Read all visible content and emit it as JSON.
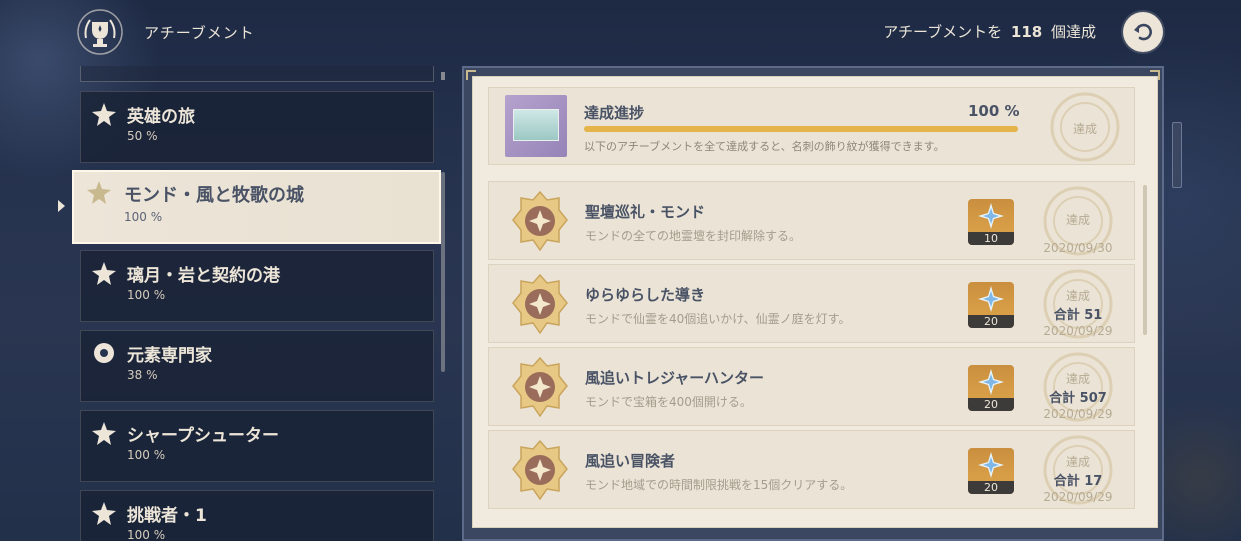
{
  "header": {
    "title": "アチーブメント",
    "progress_prefix": "アチーブメントを",
    "progress_count": "118",
    "progress_suffix": "個達成"
  },
  "sidebar": {
    "categories": [
      {
        "name": "英雄の旅",
        "percent": "50 %"
      },
      {
        "name": "モンド・風と牧歌の城",
        "percent": "100 %",
        "selected": true
      },
      {
        "name": "璃月・岩と契約の港",
        "percent": "100 %"
      },
      {
        "name": "元素専門家",
        "percent": "38 %"
      },
      {
        "name": "シャープシューター",
        "percent": "100 %"
      },
      {
        "name": "挑戦者・1",
        "percent": "100 %"
      }
    ]
  },
  "summary": {
    "title": "達成進捗",
    "percent_label": "100 %",
    "progress": 1.0,
    "description": "以下のアチーブメントを全て達成すると、名刺の飾り紋が獲得できます。",
    "stamp_label": "達成"
  },
  "achievements": [
    {
      "title": "聖壇巡礼・モンド",
      "description": "モンドの全ての地霊壇を封印解除する。",
      "reward_qty": "10",
      "stamp_label": "達成",
      "total": "",
      "date": "2020/09/30"
    },
    {
      "title": "ゆらゆらした導き",
      "description": "モンドで仙霊を40個追いかけ、仙霊ノ庭を灯す。",
      "reward_qty": "20",
      "stamp_label": "達成",
      "total": "合計 51",
      "date": "2020/09/29"
    },
    {
      "title": "風追いトレジャーハンター",
      "description": "モンドで宝箱を400個開ける。",
      "reward_qty": "20",
      "stamp_label": "達成",
      "total": "合計 507",
      "date": "2020/09/29"
    },
    {
      "title": "風追い冒険者",
      "description": "モンド地域での時間制限挑戦を15個クリアする。",
      "reward_qty": "20",
      "stamp_label": "達成",
      "total": "合計 17",
      "date": "2020/09/29"
    }
  ],
  "colors": {
    "accent_gold": "#e5b54c",
    "panel_bg": "#f1ebdf",
    "text_dark": "#4a5366",
    "reward_bg": "#d69a45"
  },
  "icons": {
    "header": "trophy-emblem-icon",
    "back": "back-arrow-icon",
    "medal": "achievement-medal-icon",
    "primogem": "primogem-icon"
  }
}
